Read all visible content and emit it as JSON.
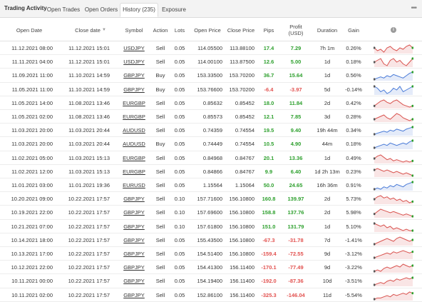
{
  "header": {
    "title": "Trading Activity",
    "tabs": [
      {
        "label": "Open Trades"
      },
      {
        "label": "Open Orders"
      },
      {
        "label": "History (235)"
      },
      {
        "label": "Exposure"
      }
    ],
    "more_glyph": "•••"
  },
  "columns": {
    "open_date": "Open Date",
    "close_date": "Close date",
    "symbol": "Symbol",
    "action": "Action",
    "lots": "Lots",
    "open_price": "Open Price",
    "close_price": "Close Price",
    "pips": "Pips",
    "profit_line1": "Profit",
    "profit_line2": "(USD)",
    "duration": "Duration",
    "gain": "Gain",
    "info_icon": "i"
  },
  "colors": {
    "positive": "#2ea02e",
    "negative": "#e2514f",
    "spark_red": "#d9534f",
    "spark_blue": "#4a7bd8"
  },
  "rows": [
    {
      "open": "11.12.2021 08:00",
      "close": "11.12.2021 15:01",
      "symbol": "USDJPY",
      "action": "Sell",
      "lots": "0.05",
      "open_price": "114.05500",
      "close_price": "113.88100",
      "pips": "17.4",
      "profit": "7.29",
      "duration": "7h 1m",
      "gain": "0.26%",
      "dir": "pos",
      "spark_color": "red",
      "spark": [
        6,
        4,
        5,
        3,
        6,
        7,
        5,
        4,
        6,
        5,
        7,
        8,
        6
      ]
    },
    {
      "open": "11.11.2021 04:00",
      "close": "11.12.2021 15:01",
      "symbol": "USDJPY",
      "action": "Sell",
      "lots": "0.05",
      "open_price": "114.00100",
      "close_price": "113.87500",
      "pips": "12.6",
      "profit": "5.00",
      "duration": "1d",
      "gain": "0.18%",
      "dir": "pos",
      "spark_color": "red",
      "spark": [
        4,
        5,
        6,
        3,
        2,
        5,
        6,
        4,
        5,
        3,
        2,
        4,
        6
      ]
    },
    {
      "open": "11.09.2021 11:00",
      "close": "11.10.2021 14:59",
      "symbol": "GBPJPY",
      "action": "Buy",
      "lots": "0.05",
      "open_price": "153.33500",
      "close_price": "153.70200",
      "pips": "36.7",
      "profit": "15.64",
      "duration": "1d",
      "gain": "0.56%",
      "dir": "pos",
      "spark_color": "blue",
      "spark": [
        3,
        4,
        5,
        4,
        6,
        5,
        7,
        6,
        5,
        4,
        6,
        8,
        9
      ]
    },
    {
      "open": "11.05.2021 11:00",
      "close": "11.10.2021 14:59",
      "symbol": "GBPJPY",
      "action": "Buy",
      "lots": "0.05",
      "open_price": "153.76600",
      "close_price": "153.70200",
      "pips": "-6.4",
      "profit": "-3.97",
      "duration": "5d",
      "gain": "-0.14%",
      "dir": "neg",
      "spark_color": "blue",
      "spark": [
        6,
        5,
        3,
        4,
        2,
        3,
        5,
        4,
        6,
        3,
        4,
        5,
        6
      ]
    },
    {
      "open": "11.05.2021 14:00",
      "close": "11.08.2021 13:46",
      "symbol": "EURGBP",
      "action": "Sell",
      "lots": "0.05",
      "open_price": "0.85632",
      "close_price": "0.85452",
      "pips": "18.0",
      "profit": "11.84",
      "duration": "2d",
      "gain": "0.42%",
      "dir": "pos",
      "spark_color": "red",
      "spark": [
        3,
        5,
        7,
        8,
        6,
        5,
        7,
        8,
        6,
        4,
        3,
        2,
        3
      ]
    },
    {
      "open": "11.05.2021 02:00",
      "close": "11.08.2021 13:46",
      "symbol": "EURGBP",
      "action": "Sell",
      "lots": "0.05",
      "open_price": "0.85573",
      "close_price": "0.85452",
      "pips": "12.1",
      "profit": "7.85",
      "duration": "3d",
      "gain": "0.28%",
      "dir": "pos",
      "spark_color": "red",
      "spark": [
        4,
        5,
        6,
        7,
        5,
        4,
        6,
        8,
        7,
        5,
        4,
        3,
        4
      ]
    },
    {
      "open": "11.03.2021 20:00",
      "close": "11.03.2021 20:44",
      "symbol": "AUDUSD",
      "action": "Sell",
      "lots": "0.05",
      "open_price": "0.74359",
      "close_price": "0.74554",
      "pips": "19.5",
      "profit": "9.40",
      "duration": "19h 44m",
      "gain": "0.34%",
      "dir": "pos",
      "spark_color": "blue",
      "spark": [
        2,
        3,
        4,
        5,
        4,
        6,
        5,
        7,
        6,
        5,
        7,
        8,
        9
      ]
    },
    {
      "open": "11.03.2021 20:00",
      "close": "11.03.2021 20:44",
      "symbol": "AUDUSD",
      "action": "Buy",
      "lots": "0.05",
      "open_price": "0.74449",
      "close_price": "0.74554",
      "pips": "10.5",
      "profit": "4.90",
      "duration": "44m",
      "gain": "0.18%",
      "dir": "pos",
      "spark_color": "blue",
      "spark": [
        3,
        4,
        5,
        6,
        5,
        7,
        6,
        5,
        6,
        7,
        6,
        8,
        9
      ]
    },
    {
      "open": "11.02.2021 05:00",
      "close": "11.03.2021 15:13",
      "symbol": "EURGBP",
      "action": "Sell",
      "lots": "0.05",
      "open_price": "0.84968",
      "close_price": "0.84767",
      "pips": "20.1",
      "profit": "13.36",
      "duration": "1d",
      "gain": "0.49%",
      "dir": "pos",
      "spark_color": "red",
      "spark": [
        5,
        7,
        8,
        6,
        4,
        5,
        3,
        4,
        3,
        2,
        3,
        2,
        3
      ]
    },
    {
      "open": "11.02.2021 12:00",
      "close": "11.03.2021 15:13",
      "symbol": "EURGBP",
      "action": "Sell",
      "lots": "0.05",
      "open_price": "0.84866",
      "close_price": "0.84767",
      "pips": "9.9",
      "profit": "6.40",
      "duration": "1d 2h 13m",
      "gain": "0.23%",
      "dir": "pos",
      "spark_color": "red",
      "spark": [
        6,
        7,
        6,
        5,
        6,
        5,
        4,
        5,
        4,
        3,
        4,
        3,
        2
      ]
    },
    {
      "open": "11.01.2021 03:00",
      "close": "11.01.2021 19:36",
      "symbol": "EURUSD",
      "action": "Sell",
      "lots": "0.05",
      "open_price": "1.15564",
      "close_price": "1.15064",
      "pips": "50.0",
      "profit": "24.65",
      "duration": "16h 36m",
      "gain": "0.91%",
      "dir": "pos",
      "spark_color": "blue",
      "spark": [
        3,
        4,
        3,
        5,
        4,
        6,
        5,
        7,
        6,
        5,
        7,
        8,
        9
      ]
    },
    {
      "open": "10.20.2021 09:00",
      "close": "10.22.2021 17:57",
      "symbol": "GBPJPY",
      "action": "Sell",
      "lots": "0.10",
      "open_price": "157.71600",
      "close_price": "156.10800",
      "pips": "160.8",
      "profit": "139.97",
      "duration": "2d",
      "gain": "5.73%",
      "dir": "pos",
      "spark_color": "red",
      "spark": [
        5,
        7,
        8,
        6,
        7,
        5,
        6,
        4,
        5,
        3,
        4,
        2,
        3
      ]
    },
    {
      "open": "10.19.2021 22:00",
      "close": "10.22.2021 17:57",
      "symbol": "GBPJPY",
      "action": "Sell",
      "lots": "0.10",
      "open_price": "157.69600",
      "close_price": "156.10800",
      "pips": "158.8",
      "profit": "137.76",
      "duration": "2d",
      "gain": "5.98%",
      "dir": "pos",
      "spark_color": "red",
      "spark": [
        4,
        6,
        8,
        7,
        6,
        5,
        6,
        5,
        4,
        3,
        4,
        3,
        2
      ]
    },
    {
      "open": "10.21.2021 07:00",
      "close": "10.22.2021 17:57",
      "symbol": "GBPJPY",
      "action": "Sell",
      "lots": "0.10",
      "open_price": "157.61800",
      "close_price": "156.10800",
      "pips": "151.0",
      "profit": "131.79",
      "duration": "1d",
      "gain": "5.10%",
      "dir": "pos",
      "spark_color": "red",
      "spark": [
        7,
        6,
        5,
        6,
        4,
        5,
        3,
        4,
        3,
        2,
        3,
        2,
        2
      ]
    },
    {
      "open": "10.14.2021 18:00",
      "close": "10.22.2021 17:57",
      "symbol": "GBPJPY",
      "action": "Sell",
      "lots": "0.05",
      "open_price": "155.43500",
      "close_price": "156.10800",
      "pips": "-67.3",
      "profit": "-31.78",
      "duration": "7d",
      "gain": "-1.41%",
      "dir": "neg",
      "spark_color": "red",
      "spark": [
        3,
        4,
        5,
        6,
        7,
        6,
        5,
        7,
        8,
        7,
        6,
        5,
        6
      ]
    },
    {
      "open": "10.13.2021 17:00",
      "close": "10.22.2021 17:57",
      "symbol": "GBPJPY",
      "action": "Sell",
      "lots": "0.05",
      "open_price": "154.51400",
      "close_price": "156.10800",
      "pips": "-159.4",
      "profit": "-72.55",
      "duration": "9d",
      "gain": "-3.12%",
      "dir": "neg",
      "spark_color": "red",
      "spark": [
        2,
        3,
        4,
        5,
        6,
        5,
        7,
        6,
        7,
        8,
        7,
        6,
        7
      ]
    },
    {
      "open": "10.12.2021 22:00",
      "close": "10.22.2021 17:57",
      "symbol": "GBPJPY",
      "action": "Sell",
      "lots": "0.05",
      "open_price": "154.41300",
      "close_price": "156.11400",
      "pips": "-170.1",
      "profit": "-77.49",
      "duration": "9d",
      "gain": "-3.22%",
      "dir": "neg",
      "spark_color": "red",
      "spark": [
        3,
        4,
        3,
        5,
        6,
        5,
        6,
        7,
        6,
        8,
        7,
        6,
        7
      ]
    },
    {
      "open": "10.11.2021 00:00",
      "close": "10.22.2021 17:57",
      "symbol": "GBPJPY",
      "action": "Sell",
      "lots": "0.05",
      "open_price": "154.19400",
      "close_price": "156.11400",
      "pips": "-192.0",
      "profit": "-87.36",
      "duration": "10d",
      "gain": "-3.51%",
      "dir": "neg",
      "spark_color": "red",
      "spark": [
        2,
        3,
        4,
        3,
        5,
        6,
        5,
        7,
        6,
        7,
        8,
        7,
        8
      ]
    },
    {
      "open": "10.11.2021 02:00",
      "close": "10.22.2021 17:57",
      "symbol": "GBPJPY",
      "action": "Sell",
      "lots": "0.05",
      "open_price": "152.86100",
      "close_price": "156.11400",
      "pips": "-325.3",
      "profit": "-146.04",
      "duration": "11d",
      "gain": "-5.54%",
      "dir": "neg",
      "spark_color": "red",
      "spark": [
        2,
        3,
        3,
        4,
        5,
        4,
        6,
        5,
        6,
        7,
        6,
        8,
        7
      ]
    }
  ]
}
